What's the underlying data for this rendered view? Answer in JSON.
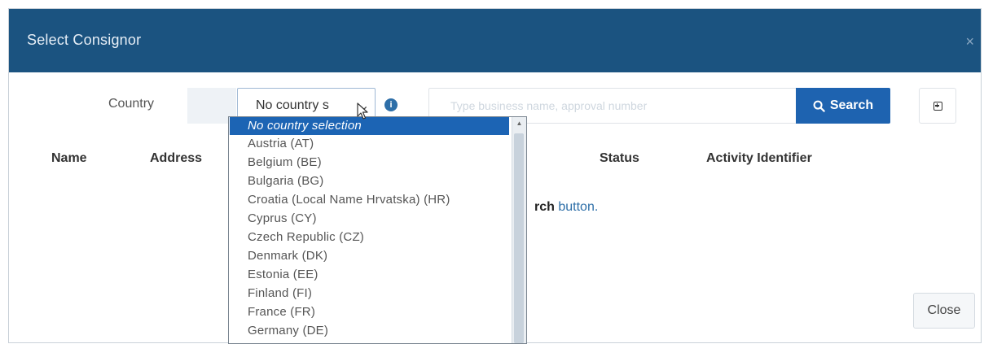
{
  "dialog": {
    "title": "Select Consignor",
    "close_glyph": "×"
  },
  "filters": {
    "country_label": "Country",
    "country_selected": "No country s",
    "info_icon": "info-icon",
    "search_placeholder": "Type business name, approval number",
    "search_value": "",
    "search_button": "Search",
    "search_icon": "magnifier-icon",
    "expand_icon": "plus-square-icon"
  },
  "table": {
    "columns": [
      "Name",
      "Address",
      "Status",
      "Activity Identifier"
    ],
    "empty_message_bold": "rch",
    "empty_message_rest": " button."
  },
  "footer": {
    "close_button": "Close"
  },
  "country_dropdown": {
    "selected_index": 0,
    "options": [
      "No country selection",
      "Austria (AT)",
      "Belgium (BE)",
      "Bulgaria (BG)",
      "Croatia (Local Name  Hrvatska) (HR)",
      "Cyprus (CY)",
      "Czech Republic (CZ)",
      "Denmark (DK)",
      "Estonia (EE)",
      "Finland (FI)",
      "France (FR)",
      "Germany (DE)"
    ]
  },
  "colors": {
    "header": "#1b5380",
    "accent": "#1e63b0",
    "selection": "#1c64b4"
  }
}
